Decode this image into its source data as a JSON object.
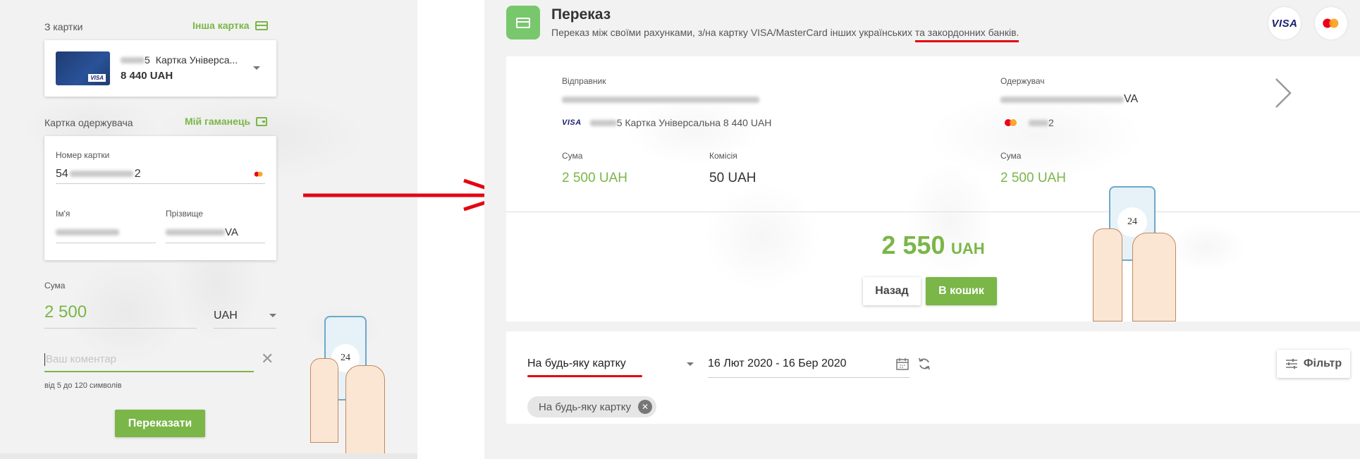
{
  "left": {
    "from_card_label": "З картки",
    "other_card_link": "Інша картка",
    "card_number_masked": "5",
    "card_name": "Картка Універса...",
    "card_balance": "8 440 UAH",
    "card_brand": "VISA",
    "recipient_label": "Картка одержувача",
    "wallet_link": "Мій гаманець",
    "card_number_label": "Номер картки",
    "card_number_prefix": "54",
    "card_number_suffix": "2",
    "first_name_label": "Ім'я",
    "last_name_label": "Прізвище",
    "last_name_suffix": "VA",
    "amount_label": "Сума",
    "amount_value": "2 500",
    "currency": "UAH",
    "comment_placeholder": "Ваш коментар",
    "comment_hint": "від 5 до 120 символів",
    "submit_label": "Переказати",
    "phone_badge": "24"
  },
  "right": {
    "title": "Переказ",
    "subtitle_main": "Переказ між своїми рахунками, з/на картку VISA/MasterCard інших українських ",
    "subtitle_underlined": "та закордонних банків.",
    "visa_logo": "VISA",
    "sender_label": "Відправник",
    "sender_card_text": "5 Картка Універсальна 8 440 UAH",
    "sender_card_brand": "VISA",
    "receiver_label": "Одержувач",
    "receiver_name_suffix": "VA",
    "receiver_card_suffix": "2",
    "sum_label": "Сума",
    "sum_value": "2 500 UAH",
    "fee_label": "Комісія",
    "fee_value": "50 UAH",
    "receiver_sum_label": "Сума",
    "receiver_sum_value": "2 500 UAH",
    "total_amount": "2 550",
    "total_currency": "UAH",
    "back_button": "Назад",
    "cart_button": "В кошик",
    "phone_badge": "24",
    "filter_card_select": "На будь-яку картку",
    "date_range": "16 Лют 2020 - 16 Бер 2020",
    "filter_button": "Фільтр",
    "chip_label": "На будь-яку картку"
  },
  "colors": {
    "accent_green": "#7ab648",
    "annotation_red": "#e30613"
  }
}
